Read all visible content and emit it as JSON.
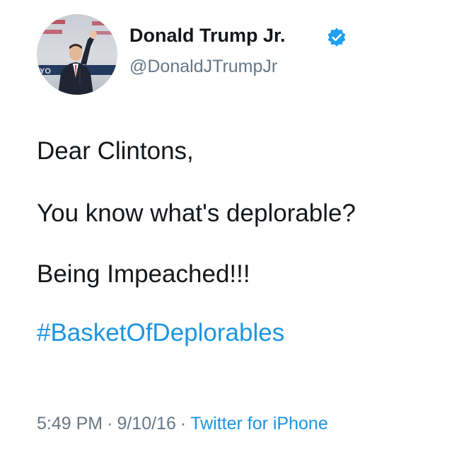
{
  "author": {
    "display_name": "Donald Trump Jr.",
    "handle": "@DonaldJTrumpJr",
    "verified_icon": "verified-badge-icon",
    "avatar_icon": "profile-photo"
  },
  "tweet": {
    "lines": [
      "Dear Clintons,",
      "You know what's deplorable?",
      "Being Impeached!!!"
    ],
    "hashtag": "#BasketOfDeplorables"
  },
  "meta": {
    "time": "5:49 PM",
    "separator": "·",
    "date": "9/10/16",
    "source": "Twitter for iPhone"
  },
  "colors": {
    "link": "#1b95e0",
    "text": "#14171a",
    "muted": "#657786",
    "verified": "#1da1f2"
  }
}
